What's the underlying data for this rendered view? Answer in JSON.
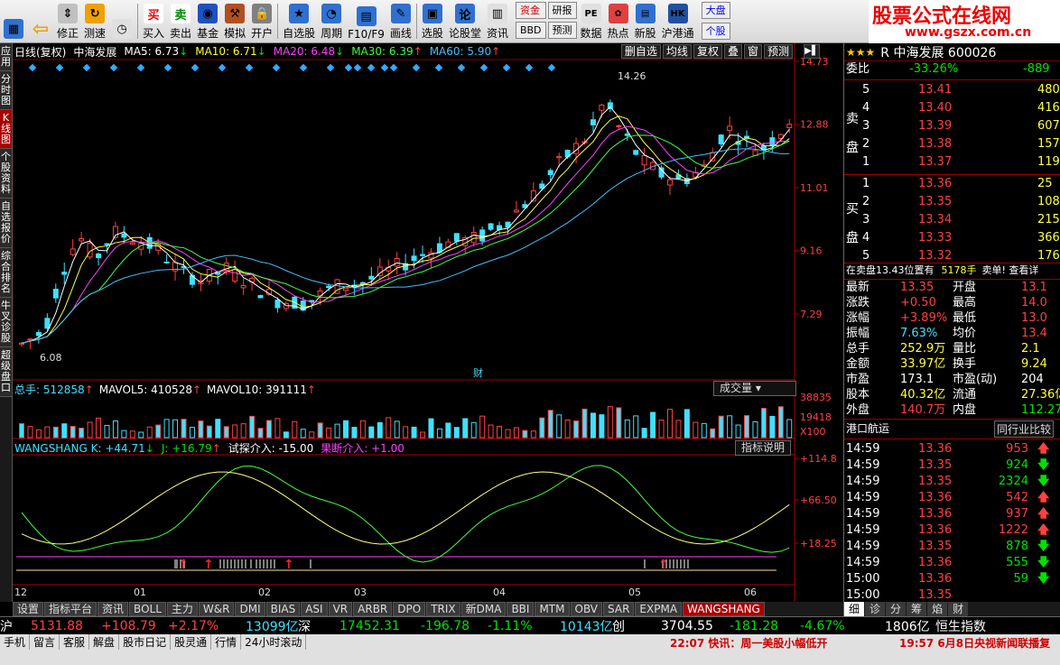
{
  "toolbar": {
    "items": [
      {
        "label": "",
        "icon": "grid-icon"
      },
      {
        "label": "",
        "icon": "back-arrow-icon"
      },
      {
        "label": "修正",
        "icon": "arrows-updown-icon"
      },
      {
        "label": "测速",
        "icon": "refresh-icon"
      },
      {
        "label": "",
        "icon": "clock-icon"
      },
      {
        "label": "买入",
        "icon": "buy-icon"
      },
      {
        "label": "卖出",
        "icon": "sell-icon"
      },
      {
        "label": "基金",
        "icon": "fund-icon"
      },
      {
        "label": "模拟",
        "icon": "hammer-icon"
      },
      {
        "label": "开户",
        "icon": "lock-icon"
      },
      {
        "label": "自选股",
        "icon": "star-icon"
      },
      {
        "label": "周期",
        "icon": "cycle-icon"
      },
      {
        "label": "F10/F9",
        "icon": "f10-icon"
      },
      {
        "label": "画线",
        "icon": "pen-icon"
      },
      {
        "label": "选股",
        "icon": "monitor-icon"
      },
      {
        "label": "论股堂",
        "icon": "lun-icon"
      },
      {
        "label": "资讯",
        "icon": "news-icon"
      }
    ],
    "box_buttons": [
      "资金",
      "研报",
      "BBD",
      "预测",
      "数据",
      "热点",
      "新股",
      "沪港通",
      "大盘",
      "个股"
    ],
    "brand_title": "股票公式在线网",
    "brand_url": "www.gszx.com.cn"
  },
  "sidebar": [
    "应用",
    "分时图",
    "K线图",
    "个股资料",
    "自选报价",
    "综合排名",
    "牛叉诊股",
    "超级盘口"
  ],
  "chart": {
    "title": "日线(复权)",
    "stock": "中海发展",
    "ma": [
      {
        "label": "MA5: 6.73",
        "arrow": "↓",
        "color": "#ffffff"
      },
      {
        "label": "MA10: 6.71",
        "arrow": "↓",
        "color": "#ffff40"
      },
      {
        "label": "MA20: 6.48",
        "arrow": "↓",
        "color": "#ff40ff"
      },
      {
        "label": "MA30: 6.39",
        "arrow": "↑",
        "color": "#40ff40"
      },
      {
        "label": "MA60: 5.90",
        "arrow": "↑",
        "color": "#40c0ff"
      }
    ],
    "right_buttons": [
      "删自选",
      "均线",
      "复权",
      "叠",
      "窗",
      "预测"
    ],
    "price_axis": [
      "14.73",
      "12.88",
      "11.01",
      "9.16",
      "7.29"
    ],
    "high_label": "14.26",
    "low_label": "6.08",
    "cai": "财",
    "vol_header": {
      "total": "总手: 512858",
      "mavol5": "MAVOL5: 410528",
      "mavol10": "MAVOL10: 391111"
    },
    "vol_axis": [
      "38835",
      "19418",
      "X100"
    ],
    "vol_btn": "成交量",
    "ind_header": {
      "k": "WANGSHANG K: +44.71",
      "j": "J: +16.79",
      "t1": "试探介入: -15.00",
      "t2": "果断介入: +1.00"
    },
    "ind_axis": [
      "+114.8",
      "+66.50",
      "+18.25"
    ],
    "ind_btn": "指标说明",
    "x_labels": [
      "12",
      "01",
      "02",
      "03",
      "04",
      "05",
      "06"
    ]
  },
  "tabs": [
    "设置",
    "指标平台",
    "资讯",
    "BOLL",
    "主力",
    "W&R",
    "DMI",
    "BIAS",
    "ASI",
    "VR",
    "ARBR",
    "DPO",
    "TRIX",
    "新DMA",
    "BBI",
    "MTM",
    "OBV",
    "SAR",
    "EXPMA",
    "WANGSHANG"
  ],
  "right": {
    "title": "R 中海发展 600026",
    "weibi": "委比",
    "weibi_val": "-33.26%",
    "weicha": "-889",
    "sell": [
      {
        "n": "5",
        "p": "13.41",
        "v": "480"
      },
      {
        "n": "4",
        "p": "13.40",
        "v": "416"
      },
      {
        "n": "3",
        "p": "13.39",
        "v": "607"
      },
      {
        "n": "2",
        "p": "13.38",
        "v": "157"
      },
      {
        "n": "1",
        "p": "13.37",
        "v": "119"
      }
    ],
    "buy": [
      {
        "n": "1",
        "p": "13.36",
        "v": "25"
      },
      {
        "n": "2",
        "p": "13.35",
        "v": "108"
      },
      {
        "n": "3",
        "p": "13.34",
        "v": "215"
      },
      {
        "n": "4",
        "p": "13.33",
        "v": "366"
      },
      {
        "n": "5",
        "p": "13.32",
        "v": "176"
      }
    ],
    "sell_label": "卖盘",
    "buy_label": "买盘",
    "notice": "在卖盘13.43位置有",
    "notice_v": "5178手",
    "notice_t": "卖单! 查看详",
    "stats": [
      [
        "最新",
        "13.35",
        "开盘",
        "13.1"
      ],
      [
        "涨跌",
        "+0.50",
        "最高",
        "14.0"
      ],
      [
        "涨幅",
        "+3.89%",
        "最低",
        "13.0"
      ],
      [
        "振幅",
        "7.63%",
        "均价",
        "13.4"
      ],
      [
        "总手",
        "252.9万",
        "量比",
        "2.1"
      ],
      [
        "金额",
        "33.97亿",
        "换手",
        "9.24"
      ],
      [
        "市盈",
        "173.1",
        "市盈(动)",
        "204"
      ],
      [
        "股本",
        "40.32亿",
        "流通",
        "27.36亿"
      ],
      [
        "外盘",
        "140.7万",
        "内盘",
        "112.27"
      ]
    ],
    "sector": "港口航运",
    "sector_btn": "同行业比较",
    "ticks": [
      [
        "14:59",
        "13.36",
        "953",
        "up"
      ],
      [
        "14:59",
        "13.35",
        "924",
        "down"
      ],
      [
        "14:59",
        "13.35",
        "2324",
        "down"
      ],
      [
        "14:59",
        "13.36",
        "542",
        "up"
      ],
      [
        "14:59",
        "13.36",
        "937",
        "up"
      ],
      [
        "14:59",
        "13.36",
        "1222",
        "up"
      ],
      [
        "14:59",
        "13.35",
        "878",
        "down"
      ],
      [
        "14:59",
        "13.36",
        "555",
        "down"
      ],
      [
        "15:00",
        "13.36",
        "59",
        "down"
      ],
      [
        "15:00",
        "13.35",
        "",
        ""
      ]
    ],
    "bottom_tabs": [
      "细",
      "诊",
      "分",
      "筹",
      "焰",
      "财"
    ]
  },
  "status": {
    "sh": "沪",
    "sh_v": "5131.88",
    "sh_c": "+108.79",
    "sh_p": "+2.17%",
    "sh_a": "13099亿",
    "sz": "深",
    "sz_v": "17452.31",
    "sz_c": "-196.78",
    "sz_p": "-1.11%",
    "sz_a": "10143亿",
    "cy": "创",
    "cy_v": "3704.55",
    "cy_c": "-181.28",
    "cy_p": "-4.67%",
    "cy_a": "1806亿",
    "hs": "恒生指数"
  },
  "bottom": {
    "items": [
      "手机",
      "留言",
      "客服",
      "解盘",
      "股市日记",
      "股灵通",
      "行情",
      "24小时滚动"
    ],
    "news1": "22:07 快讯：周一美股小幅低开",
    "news2": "19:57 6月8日央视新闻联播复"
  }
}
